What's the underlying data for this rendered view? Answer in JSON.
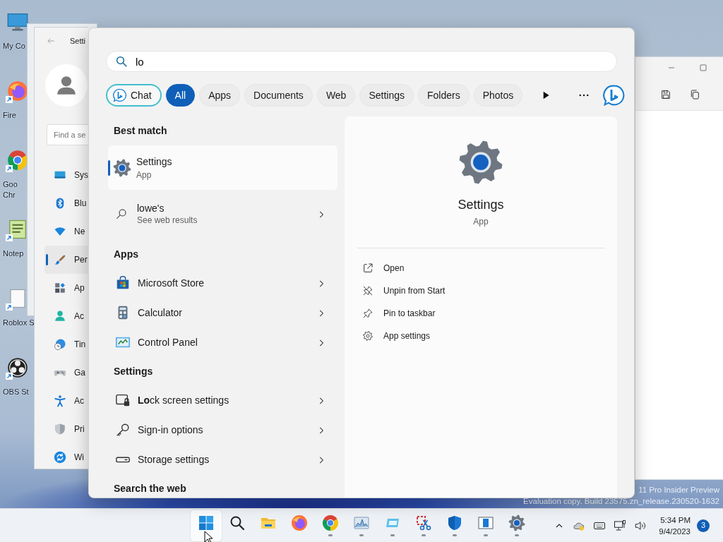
{
  "desktop_icons": [
    {
      "label": [
        "My Co"
      ],
      "kind": "monitor",
      "shortcut": false
    },
    {
      "label": [
        "Fire"
      ],
      "kind": "firefox",
      "shortcut": true
    },
    {
      "label": [
        "Goo",
        "Chr"
      ],
      "kind": "chrome",
      "shortcut": true
    },
    {
      "label": [
        "Notep"
      ],
      "kind": "notepad",
      "shortcut": true
    },
    {
      "label": [
        "Roblox S"
      ],
      "kind": "file",
      "shortcut": true
    },
    {
      "label": [
        "OBS St"
      ],
      "kind": "obs",
      "shortcut": true
    }
  ],
  "settings_window": {
    "title": "Setti",
    "search_placeholder": "Find a se",
    "nav": [
      {
        "label": "Sys",
        "kind": "system",
        "selected": false
      },
      {
        "label": "Blu",
        "kind": "bluetooth",
        "selected": false
      },
      {
        "label": "Ne",
        "kind": "network",
        "selected": false
      },
      {
        "label": "Per",
        "kind": "brush",
        "selected": true
      },
      {
        "label": "Ap",
        "kind": "apps",
        "selected": false
      },
      {
        "label": "Ac",
        "kind": "accounts",
        "selected": false
      },
      {
        "label": "Tin",
        "kind": "time",
        "selected": false
      },
      {
        "label": "Ga",
        "kind": "gaming",
        "selected": false
      },
      {
        "label": "Ac",
        "kind": "accessibility",
        "selected": false
      },
      {
        "label": "Pri",
        "kind": "privacy",
        "selected": false
      },
      {
        "label": "Wi",
        "kind": "update",
        "selected": false
      }
    ]
  },
  "build_info": [
    "11 Pro Insider Preview",
    "Evaluation copy. Build 23575.zn_release.230520-1632"
  ],
  "search": {
    "value": "lo",
    "chips": [
      {
        "label": "Chat",
        "kind": "chat",
        "selected": false
      },
      {
        "label": "All",
        "kind": "filter",
        "selected": true
      },
      {
        "label": "Apps",
        "kind": "filter",
        "selected": false
      },
      {
        "label": "Documents",
        "kind": "filter",
        "selected": false
      },
      {
        "label": "Web",
        "kind": "filter",
        "selected": false
      },
      {
        "label": "Settings",
        "kind": "filter",
        "selected": false
      },
      {
        "label": "Folders",
        "kind": "filter",
        "selected": false
      },
      {
        "label": "Photos",
        "kind": "filter",
        "selected": false
      }
    ]
  },
  "results": {
    "best_match_heading": "Best match",
    "best_match": {
      "title": "Settings",
      "subtitle": "App",
      "selected": true
    },
    "web_result": {
      "title": "lowe's",
      "subtitle": "See web results"
    },
    "sections": [
      {
        "heading": "Apps",
        "items": [
          {
            "label": "Microsoft Store",
            "kind": "store"
          },
          {
            "label": "Calculator",
            "kind": "calculator"
          },
          {
            "label": "Control Panel",
            "kind": "control-panel"
          }
        ]
      },
      {
        "heading": "Settings",
        "items": [
          {
            "label": "**Lo**ck screen settings",
            "kind": "lock-screen"
          },
          {
            "label": "Sign-in options",
            "kind": "key"
          },
          {
            "label": "Storage settings",
            "kind": "storage"
          }
        ]
      }
    ],
    "search_web_heading": "Search the web"
  },
  "detail": {
    "title": "Settings",
    "subtitle": "App",
    "actions": [
      {
        "label": "Open",
        "kind": "open"
      },
      {
        "label": "Unpin from Start",
        "kind": "unpin"
      },
      {
        "label": "Pin to taskbar",
        "kind": "pin"
      },
      {
        "label": "App settings",
        "kind": "app-settings"
      }
    ]
  },
  "taskbar": {
    "apps": [
      {
        "kind": "start",
        "selected": true,
        "running": false
      },
      {
        "kind": "search",
        "selected": false,
        "running": false
      },
      {
        "kind": "folder",
        "selected": false,
        "running": false
      },
      {
        "kind": "firefox",
        "selected": false,
        "running": false
      },
      {
        "kind": "chrome",
        "selected": false,
        "running": true
      },
      {
        "kind": "perfmon",
        "selected": false,
        "running": true
      },
      {
        "kind": "window-blue",
        "selected": false,
        "running": true
      },
      {
        "kind": "snip",
        "selected": false,
        "running": true
      },
      {
        "kind": "shield",
        "selected": false,
        "running": true
      },
      {
        "kind": "display",
        "selected": false,
        "running": true
      },
      {
        "kind": "gear",
        "selected": false,
        "running": true
      }
    ],
    "time": "5:34 PM",
    "date": "9/4/2023",
    "notifications": "3"
  }
}
